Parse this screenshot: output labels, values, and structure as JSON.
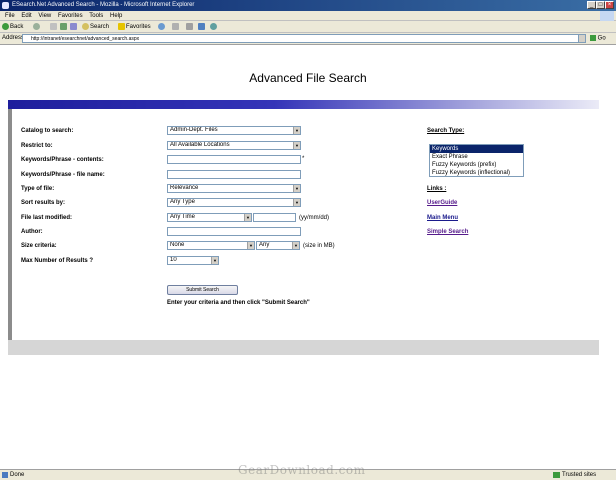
{
  "window": {
    "title": "ESearch.Net Advanced Search - Mozilla - Microsoft Internet Explorer",
    "menu": [
      "File",
      "Edit",
      "View",
      "Favorites",
      "Tools",
      "Help"
    ],
    "toolbar": {
      "back": "Back",
      "search": "Search",
      "favorites": "Favorites"
    },
    "address_label": "Address",
    "address_url": "http://intranet/esearchnet/advanced_search.aspx",
    "go_label": "Go",
    "status": "Done",
    "zone": "Trusted sites"
  },
  "page": {
    "title": "Advanced File Search"
  },
  "form": {
    "catalog": {
      "label": "Catalog to search:",
      "value": "Admin-Dept. Files"
    },
    "restrict": {
      "label": "Restrict to:",
      "value": "All Available Locations"
    },
    "keywords_contents": {
      "label": "Keywords/Phrase - contents:",
      "value": "",
      "required_mark": "*"
    },
    "keywords_filename": {
      "label": "Keywords/Phrase - file name:",
      "value": ""
    },
    "file_type": {
      "label": "Type of file:",
      "value": "Relevance"
    },
    "sort": {
      "label": "Sort results by:",
      "value": "Any Type"
    },
    "modified": {
      "label": "File last modified:",
      "value": "Any Time",
      "date_value": "",
      "date_hint": "(yy/mm/dd)"
    },
    "author": {
      "label": "Author:",
      "value": ""
    },
    "size": {
      "label": "Size criteria:",
      "value": "None",
      "size_value": "Any",
      "unit_hint": "(size in MB)"
    },
    "max_results": {
      "label": "Max Number of Results ?",
      "value": "10"
    },
    "submit_label": "Submit Search",
    "hint": "Enter your criteria and then click \"Submit Search\""
  },
  "sidebar": {
    "search_type_heading": "Search Type:",
    "search_types": [
      "Keywords",
      "Exact Phrase",
      "Fuzzy Keywords (prefix)",
      "Fuzzy Keywords (inflectional)"
    ],
    "selected_search_type": "Keywords",
    "links_heading": "Links :",
    "links": [
      "UserGuide",
      "Main Menu",
      "Simple Search"
    ]
  },
  "watermark": "GearDownload.com"
}
